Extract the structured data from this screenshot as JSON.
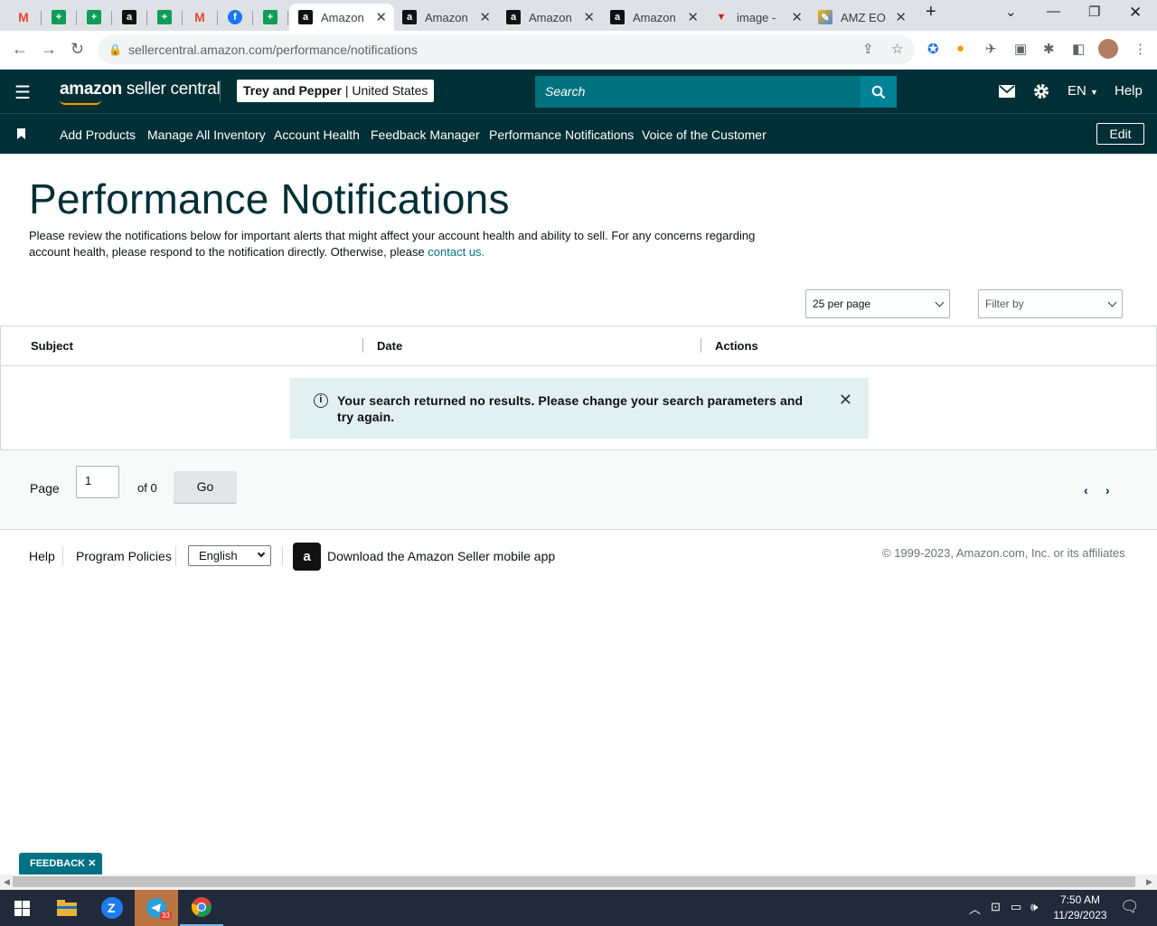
{
  "browser": {
    "tabs": [
      {
        "title": "",
        "icon": "gmail-icon",
        "glyph": "M",
        "kind": "gm"
      },
      {
        "title": "",
        "icon": "sheets-icon",
        "glyph": "+",
        "kind": "sh"
      },
      {
        "title": "",
        "icon": "sheets-icon",
        "glyph": "+",
        "kind": "sh"
      },
      {
        "title": "",
        "icon": "amazon-icon",
        "glyph": "a",
        "kind": "az"
      },
      {
        "title": "",
        "icon": "sheets-icon",
        "glyph": "+",
        "kind": "sh"
      },
      {
        "title": "",
        "icon": "gmail-icon",
        "glyph": "M",
        "kind": "gm"
      },
      {
        "title": "",
        "icon": "facebook-icon",
        "glyph": "f",
        "kind": "fb"
      },
      {
        "title": "",
        "icon": "sheets-icon",
        "glyph": "+",
        "kind": "sh"
      },
      {
        "title": "Amazon",
        "icon": "amazon-icon",
        "glyph": "a",
        "kind": "az",
        "active": true
      },
      {
        "title": "Amazon",
        "icon": "amazon-icon",
        "glyph": "a",
        "kind": "az"
      },
      {
        "title": "Amazon",
        "icon": "amazon-icon",
        "glyph": "a",
        "kind": "az"
      },
      {
        "title": "Amazon",
        "icon": "amazon-icon",
        "glyph": "a",
        "kind": "az"
      },
      {
        "title": "image -",
        "icon": "image-tab-icon",
        "glyph": "▼",
        "kind": "img"
      },
      {
        "title": "AMZ EO",
        "icon": "amz-eo-icon",
        "glyph": "✎",
        "kind": "amz"
      }
    ],
    "url": "sellercentral.amazon.com/performance/notifications"
  },
  "header": {
    "logo_bold": "amazon",
    "logo_rest": " seller central",
    "account_name": "Trey and Pepper",
    "account_region": "United States",
    "search_placeholder": "Search",
    "language": "EN",
    "help": "Help"
  },
  "subnav": {
    "items": [
      "Add Products",
      "Manage All Inventory",
      "Account Health",
      "Feedback Manager",
      "Performance Notifications",
      "Voice of the Customer"
    ],
    "edit": "Edit"
  },
  "main": {
    "title": "Performance Notifications",
    "intro": "Please review the notifications below for important alerts that might affect your account health and ability to sell. For any concerns regarding account health, please respond to the notification directly. Otherwise, please ",
    "intro_link": "contact us.",
    "per_page": "25 per page",
    "filter": "Filter by",
    "columns": [
      "Subject",
      "Date",
      "Actions"
    ],
    "empty_message": "Your search returned no results. Please change your search parameters and try again.",
    "pagination": {
      "page_label": "Page",
      "page_value": "1",
      "of_label": "of 0",
      "go": "Go"
    }
  },
  "footer": {
    "help": "Help",
    "policies": "Program Policies",
    "language": "English",
    "app": "Download the Amazon Seller mobile app",
    "copyright": "© 1999-2023, Amazon.com, Inc. or its affiliates"
  },
  "feedback_tab": "FEEDBACK",
  "taskbar": {
    "time": "7:50 AM",
    "date": "11/29/2023",
    "telegram_badge": "33"
  },
  "colors": {
    "header": "#002f36",
    "link": "#007185",
    "search": "#00727f",
    "alert_bg": "#e3f0f1"
  }
}
